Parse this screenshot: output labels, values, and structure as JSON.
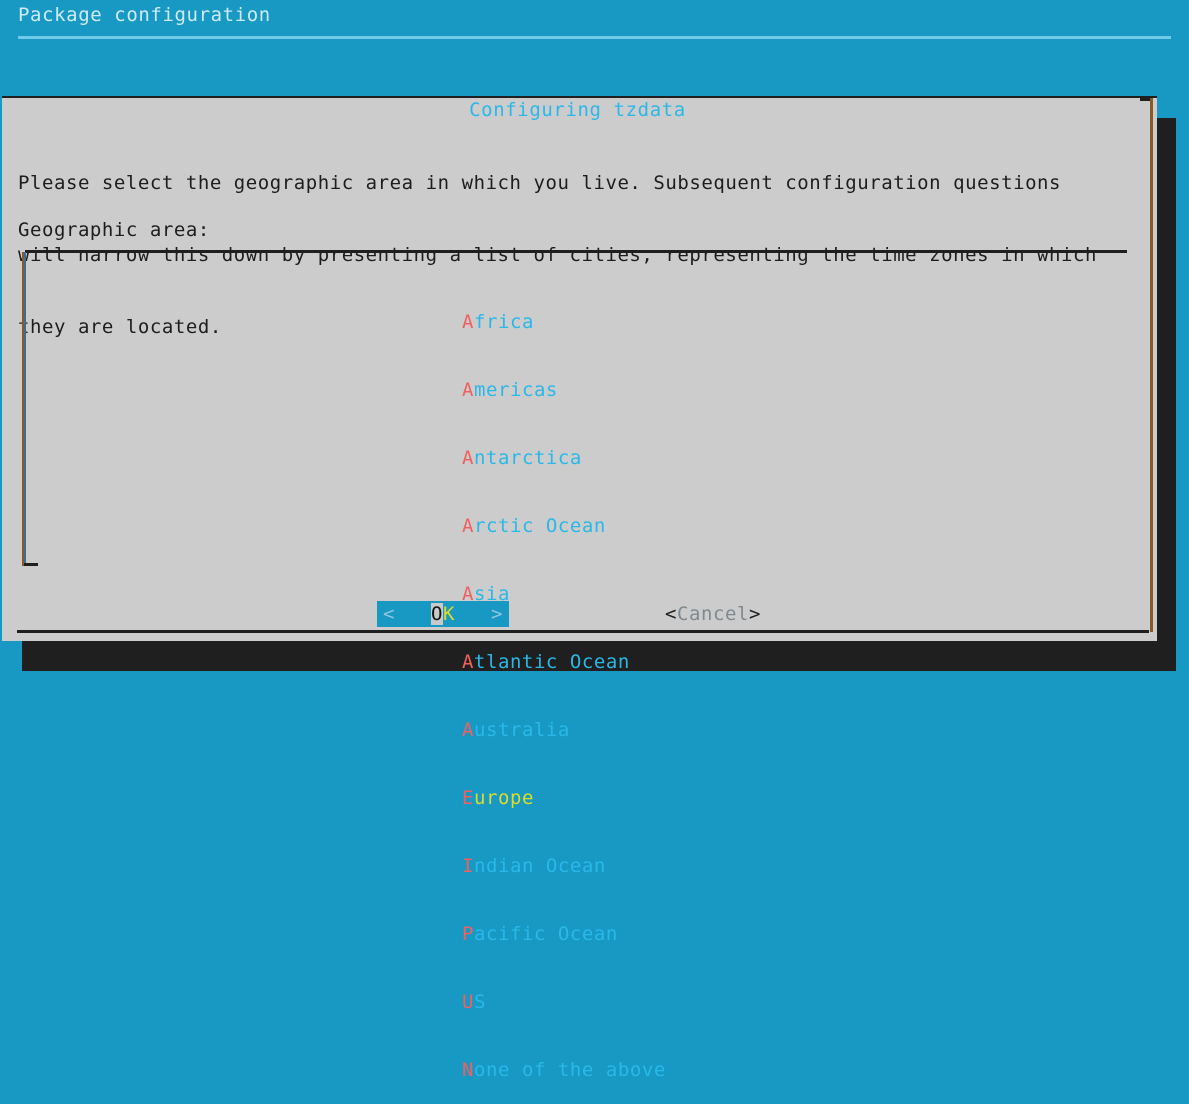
{
  "header": {
    "title": "Package configuration"
  },
  "dialog": {
    "title": "Configuring tzdata",
    "body_lines": [
      "Please select the geographic area in which you live. Subsequent configuration questions",
      "will narrow this down by presenting a list of cities, representing the time zones in which",
      "they are located."
    ],
    "field_label": "Geographic area:"
  },
  "list": {
    "selected": "Europe",
    "items": [
      {
        "hotkey": "A",
        "rest": "frica",
        "label": "Africa",
        "selected": false
      },
      {
        "hotkey": "A",
        "rest": "mericas",
        "label": "Americas",
        "selected": false
      },
      {
        "hotkey": "A",
        "rest": "ntarctica",
        "label": "Antarctica",
        "selected": false
      },
      {
        "hotkey": "A",
        "rest": "rctic Ocean",
        "label": "Arctic Ocean",
        "selected": false
      },
      {
        "hotkey": "A",
        "rest": "sia",
        "label": "Asia",
        "selected": false
      },
      {
        "hotkey": "A",
        "rest": "tlantic Ocean",
        "label": "Atlantic Ocean",
        "selected": false
      },
      {
        "hotkey": "A",
        "rest": "ustralia",
        "label": "Australia",
        "selected": false
      },
      {
        "hotkey": "E",
        "rest": "urope",
        "label": "Europe",
        "selected": true
      },
      {
        "hotkey": "I",
        "rest": "ndian Ocean",
        "label": "Indian Ocean",
        "selected": false
      },
      {
        "hotkey": "P",
        "rest": "acific Ocean",
        "label": "Pacific Ocean",
        "selected": false
      },
      {
        "hotkey": "U",
        "rest": "S",
        "label": "US",
        "selected": false
      },
      {
        "hotkey": "N",
        "rest": "one of the above",
        "label": "None of the above",
        "selected": false
      }
    ]
  },
  "buttons": {
    "ok": {
      "left_bracket": "<",
      "pad_left": "   ",
      "hotkey_char": "O",
      "rest": "K",
      "pad_right": "   ",
      "right_bracket": ">",
      "label": "<   OK   >"
    },
    "cancel": {
      "left_bracket": "<",
      "text": "Cancel",
      "right_bracket": ">",
      "label": "<Cancel>"
    }
  },
  "colors": {
    "background": "#1799c4",
    "dialog_bg": "#cccccc",
    "title_cyan": "#29b8e8",
    "hotkey_red": "#f0605f",
    "selected_yellow": "#dcdc28",
    "shadow": "#1f1f1f",
    "header_rule": "#6fcbe6",
    "header_text": "#cfeaf5"
  }
}
